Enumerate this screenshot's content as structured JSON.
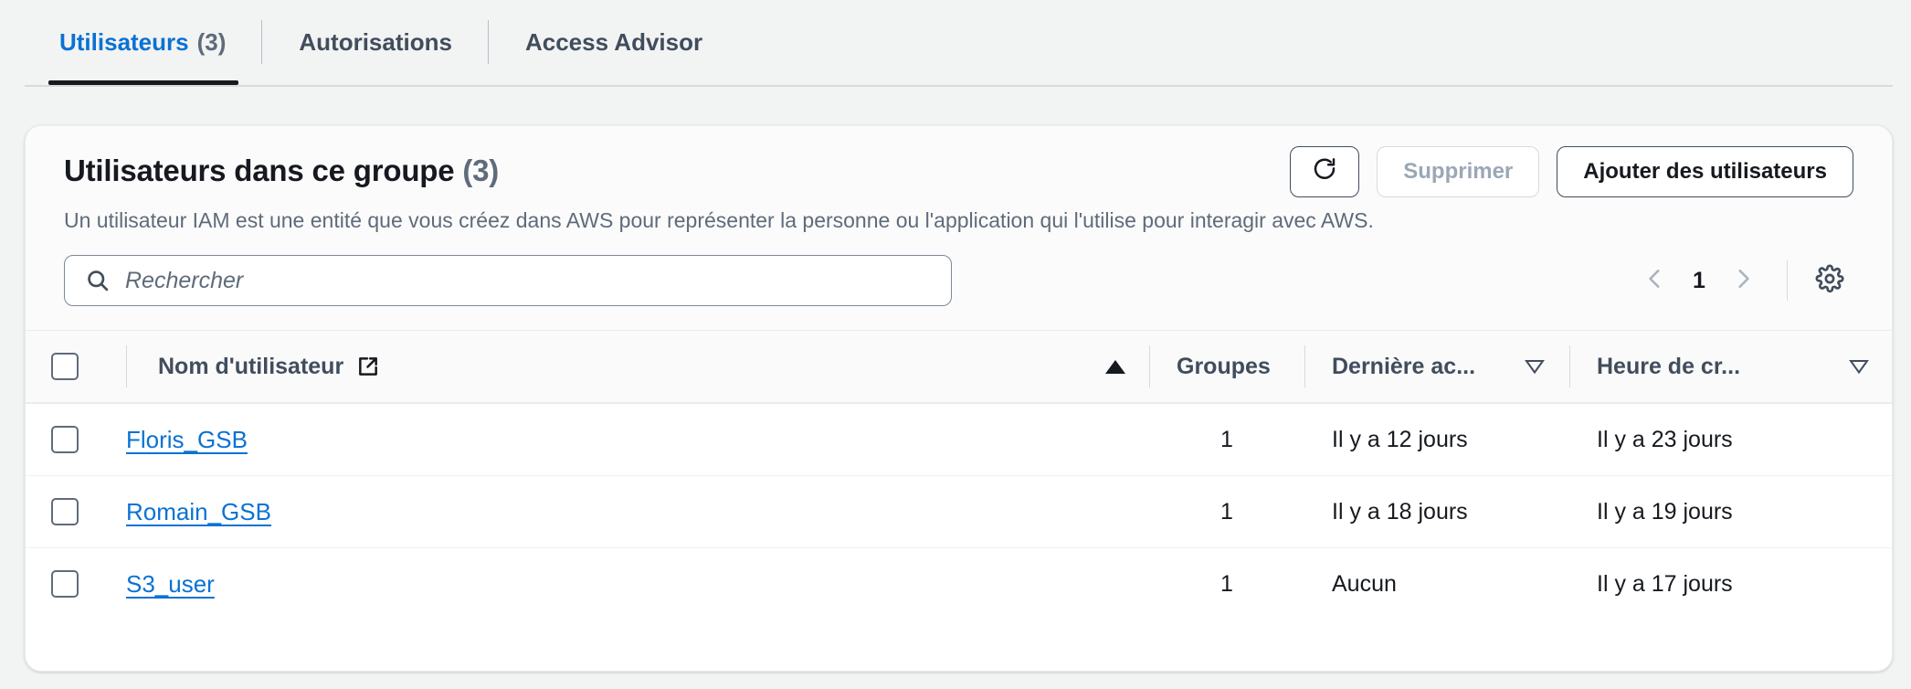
{
  "tabs": [
    {
      "label": "Utilisateurs",
      "count": "(3)",
      "active": true
    },
    {
      "label": "Autorisations",
      "count": "",
      "active": false
    },
    {
      "label": "Access Advisor",
      "count": "",
      "active": false
    }
  ],
  "card": {
    "title": "Utilisateurs dans ce groupe",
    "title_count": "(3)",
    "description": "Un utilisateur IAM est une entité que vous créez dans AWS pour représenter la personne ou l'application qui l'utilise pour interagir avec AWS.",
    "actions": {
      "refresh_icon": "refresh-icon",
      "delete_label": "Supprimer",
      "add_users_label": "Ajouter des utilisateurs"
    }
  },
  "search": {
    "placeholder": "Rechercher",
    "value": "",
    "icon": "search-icon"
  },
  "pagination": {
    "prev_icon": "chevron-left-icon",
    "page": "1",
    "next_icon": "chevron-right-icon",
    "settings_icon": "gear-icon"
  },
  "table": {
    "columns": [
      {
        "key": "select",
        "label": "",
        "sort": "none"
      },
      {
        "key": "username",
        "label": "Nom d'utilisateur",
        "sort": "asc",
        "external_link_icon": "external-link-icon"
      },
      {
        "key": "groups",
        "label": "Groupes",
        "sort": "none"
      },
      {
        "key": "last_activity",
        "label": "Dernière ac...",
        "sort": "desc"
      },
      {
        "key": "created",
        "label": "Heure de cr...",
        "sort": "desc"
      }
    ],
    "rows": [
      {
        "username": "Floris_GSB",
        "groups": "1",
        "last_activity": "Il y a 12 jours",
        "created": "Il y a 23 jours"
      },
      {
        "username": "Romain_GSB",
        "groups": "1",
        "last_activity": "Il y a 18 jours",
        "created": "Il y a 19 jours"
      },
      {
        "username": "S3_user",
        "groups": "1",
        "last_activity": "Aucun",
        "created": "Il y a 17 jours"
      }
    ]
  },
  "colors": {
    "accent_blue": "#0972d3",
    "text_primary": "#16191f",
    "text_secondary": "#5f6b7a",
    "page_bg": "#f2f3f3",
    "card_bg": "#ffffff",
    "border": "#e9ebed"
  }
}
